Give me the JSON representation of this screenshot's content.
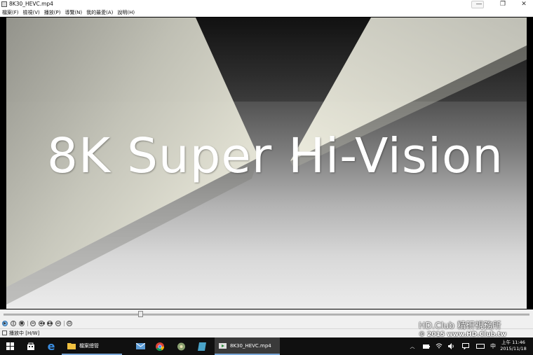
{
  "window": {
    "title": "8K30_HEVC.mp4",
    "min_glyph": "—",
    "max_glyph": "❐",
    "close_glyph": "✕",
    "app_icon": "video-file-icon"
  },
  "menu": {
    "items": [
      "檔案(F)",
      "檢視(V)",
      "播放(P)",
      "導覽(N)",
      "我的最愛(A)",
      "說明(H)"
    ]
  },
  "video": {
    "caption": "8K Super Hi-Vision"
  },
  "seek": {
    "position_fraction": 0.26
  },
  "controls": {
    "glyphs": [
      "▶",
      "‖",
      "■",
      "⏮",
      "◀◀",
      "▶▶",
      "⏭",
      "⊟"
    ]
  },
  "status": {
    "text": "播放中 [H/W]"
  },
  "taskbar": {
    "explorer_label": "檔案總管",
    "player_label": "8K30_HEVC.mp4",
    "ime": "中",
    "clock_time": "上午 11:46",
    "clock_date": "2015/11/18"
  },
  "watermark": {
    "line1": "HD.Club 精研視務所",
    "line2": "© 2015  www.HD.Club.tw"
  },
  "colors": {
    "taskbar": "#101010",
    "accent": "#7aa7d8"
  }
}
